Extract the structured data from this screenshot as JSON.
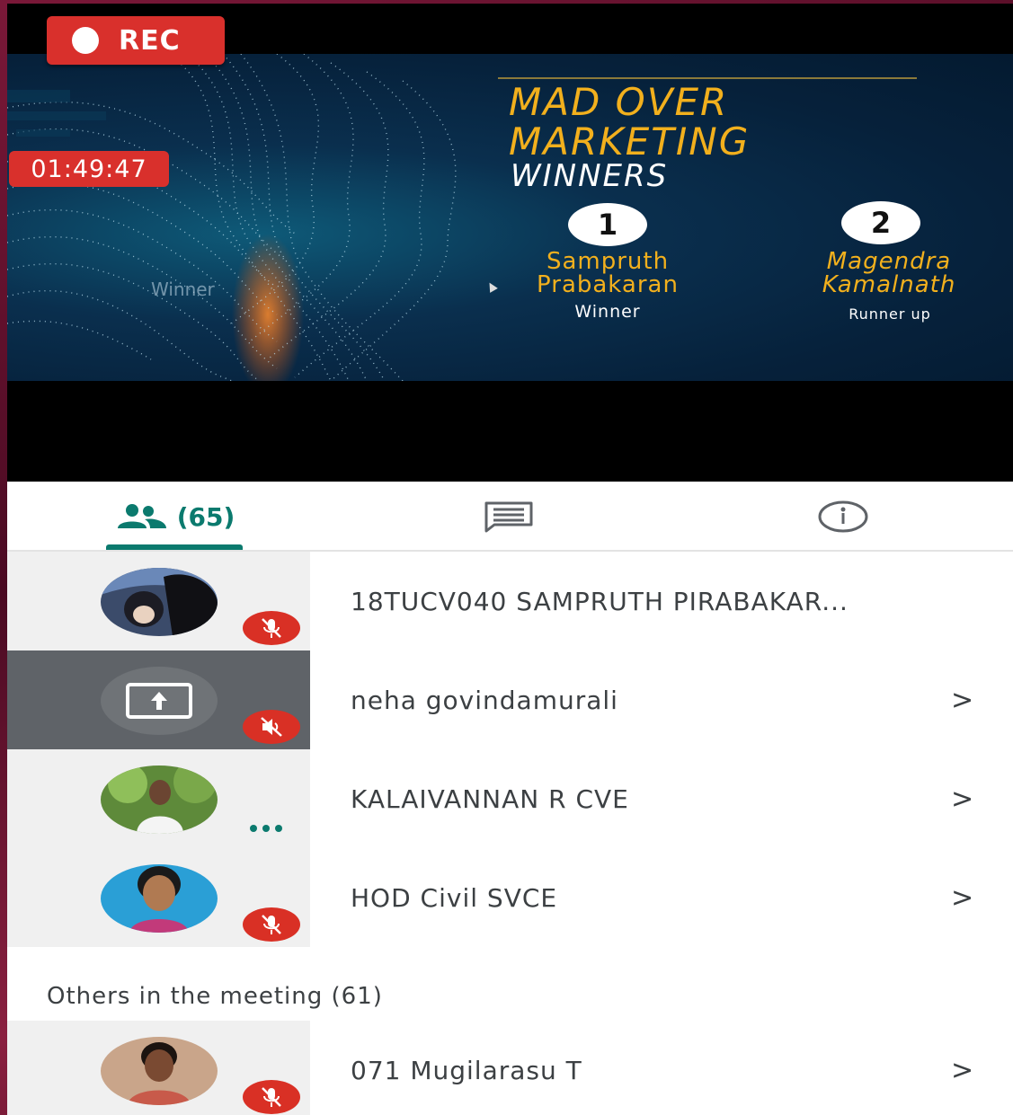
{
  "recording": {
    "label": "REC",
    "elapsed": "01:49:47"
  },
  "slide": {
    "title_line1": "MAD OVER",
    "title_line2": "MARKETING",
    "subtitle": "WINNERS",
    "ghost_text": "Winner",
    "winners": [
      {
        "rank": "1",
        "name_line1": "Sampruth",
        "name_line2": "Prabakaran",
        "role": "Winner"
      },
      {
        "rank": "2",
        "name_line1": "Magendra",
        "name_line2": "Kamalnath",
        "role": "Runner up"
      }
    ]
  },
  "tabs": {
    "people_count": "(65)",
    "people_icon": "people-icon",
    "chat_icon": "chat-icon",
    "info_icon": "info-icon",
    "accent_color": "#0b7a6e"
  },
  "participants": [
    {
      "name": "18TUCV040 SAMPRUTH PIRABAKAR...",
      "status": "muted",
      "chevron": ""
    },
    {
      "name": "neha govindamurali",
      "status": "muted-presenting",
      "chevron": ">"
    },
    {
      "name": "KALAIVANNAN R CVE",
      "status": "speaking",
      "chevron": ">"
    },
    {
      "name": "HOD Civil SVCE",
      "status": "muted",
      "chevron": ">"
    }
  ],
  "others": {
    "label": "Others in the meeting (61)",
    "participants": [
      {
        "name": "071 Mugilarasu T",
        "status": "muted",
        "chevron": ">"
      }
    ]
  },
  "colors": {
    "mute_red": "#d93025",
    "rec_red": "#d9302c",
    "slide_gold": "#f2b01d"
  }
}
